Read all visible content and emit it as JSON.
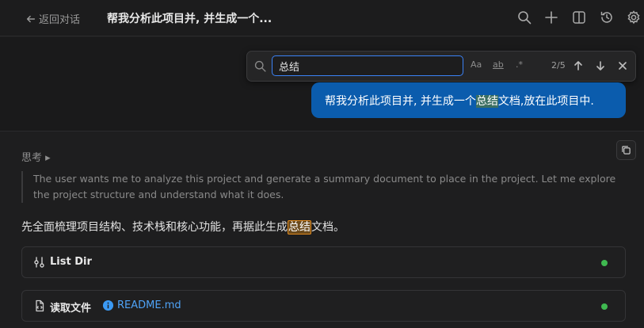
{
  "header": {
    "back_label": "返回对话",
    "title": "帮我分析此项目并, 并生成一个..."
  },
  "icons": {
    "search": "search-icon",
    "add": "plus-icon",
    "split": "split-panel-icon",
    "history": "history-icon",
    "settings": "gear-icon"
  },
  "find": {
    "query": "总结",
    "match_case": "Aa",
    "whole_word": "ab",
    "regex": ".*",
    "count": "2/5"
  },
  "user_message": {
    "before": "帮我分析此项目并, 并生成一个",
    "match": "总结",
    "after": "文档,放在此项目中."
  },
  "thinking": {
    "label": "思考 ▸",
    "text": "The user wants me to analyze this project and generate a summary document to place in the project. Let me explore the project structure and understand what it does."
  },
  "summary": {
    "before": "先全面梳理项目结构、技术栈和核心功能，再据此生成",
    "match": "总结",
    "after": "文档。"
  },
  "tools": [
    {
      "label": "List Dir",
      "status": "success"
    },
    {
      "label": "读取文件",
      "file": "README.md",
      "status": "success"
    }
  ],
  "colors": {
    "accent": "#0b5cad",
    "success": "#3fb950",
    "highlight_active": "#e08a1e",
    "link": "#4fa3f7"
  }
}
